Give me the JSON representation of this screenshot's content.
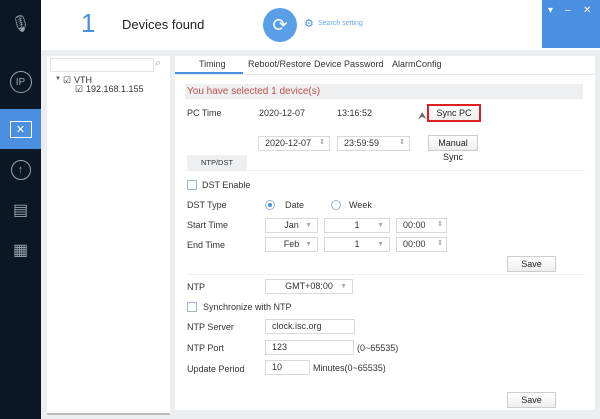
{
  "sidebar": {
    "items": [
      {
        "icon": "microphone-icon"
      },
      {
        "icon": "ip-icon"
      },
      {
        "icon": "tools-icon",
        "active": true
      },
      {
        "icon": "upgrade-icon"
      },
      {
        "icon": "document-list-icon"
      },
      {
        "icon": "building-settings-icon"
      }
    ]
  },
  "header": {
    "count": "1",
    "title": "Devices found",
    "search_setting": "Search setting"
  },
  "window": {
    "menu": "▾",
    "minimize": "–",
    "close": "✕"
  },
  "tree": {
    "search_placeholder": "",
    "root": "VTH",
    "child": "192.168.1.155"
  },
  "tabs": [
    "Timing",
    "Reboot/Restore",
    "Device Password",
    "AlarmConfig"
  ],
  "timing": {
    "selected_msg": "You have selected 1 device(s)",
    "pc_time_label": "PC Time",
    "pc_date": "2020-12-07",
    "pc_time": "13:16:52",
    "sync_pc": "Sync PC",
    "manual_date": "2020-12-07",
    "manual_time": "23:59:59",
    "manual_sync": "Manual Sync",
    "subtab": "NTP/DST",
    "dst_enable": "DST Enable",
    "dst_type_label": "DST Type",
    "date": "Date",
    "week": "Week",
    "start_label": "Start Time",
    "start_month": "Jan",
    "start_day": "1",
    "start_time": "00:00",
    "end_label": "End Time",
    "end_month": "Feb",
    "end_day": "1",
    "end_time": "00:00",
    "save": "Save",
    "ntp_label": "NTP",
    "ntp_zone": "GMT+08:00",
    "sync_ntp": "Synchronize with NTP",
    "server_label": "NTP Server",
    "server": "clock.isc.org",
    "port_label": "NTP Port",
    "port": "123",
    "port_range": "(0~65535)",
    "period_label": "Update Period",
    "period": "10",
    "period_unit": "Minutes(0~65535)"
  },
  "colors": {
    "accent": "#4a8fe0",
    "sidebar": "#0b1724",
    "warning_text": "#c0504d",
    "highlight_border": "#e02020"
  }
}
